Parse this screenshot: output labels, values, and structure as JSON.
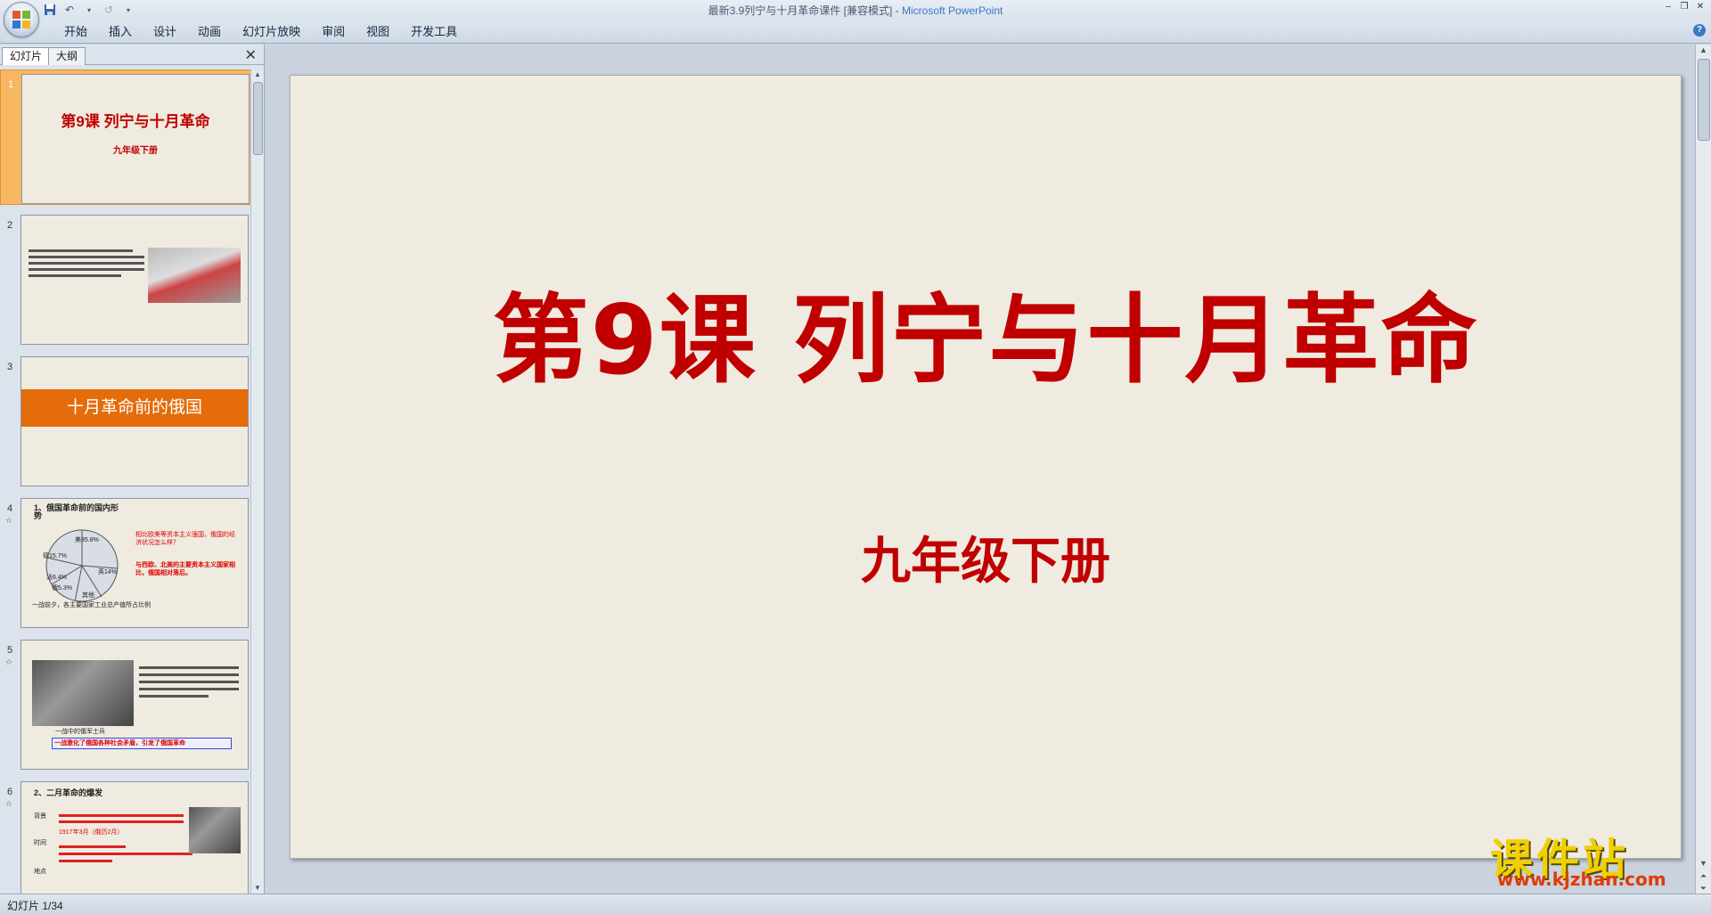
{
  "window": {
    "title": "最新3.9列宁与十月革命课件 [兼容模式] - ",
    "app_name": "Microsoft PowerPoint"
  },
  "ribbon": {
    "tabs": [
      "开始",
      "插入",
      "设计",
      "动画",
      "幻灯片放映",
      "审阅",
      "视图",
      "开发工具"
    ]
  },
  "left_pane": {
    "tabs": [
      "幻灯片",
      "大纲"
    ],
    "thumbnails": [
      {
        "num": "1",
        "title": "第9课 列宁与十月革命",
        "subtitle": "九年级下册"
      },
      {
        "num": "2",
        "text": "文字与图片"
      },
      {
        "num": "3",
        "banner": "十月革命前的俄国"
      },
      {
        "num": "4",
        "heading": "1、俄国革命前的国内形势",
        "pie_labels": [
          "美35.8%",
          "英14%",
          "德15.7%",
          "法6.4%",
          "俄5.3%",
          "其他"
        ],
        "q1": "相比欧美等资本主义强国，俄国的经济状况怎么样？",
        "q2": "与西欧、北美的主要资本主义国家相比，俄国相对落后。",
        "caption": "一战前夕，各主要国家工业总产值所占比例"
      },
      {
        "num": "5",
        "caption": "一战中的俄军士兵",
        "boxed": "一战激化了俄国各种社会矛盾，引发了俄国革命"
      },
      {
        "num": "6",
        "heading": "2、二月革命的爆发",
        "labels": [
          "背景",
          "时间",
          "地点"
        ],
        "date": "1917年3月（俄历2月）"
      }
    ]
  },
  "slide": {
    "title": "第9课 列宁与十月革命",
    "subtitle": "九年级下册"
  },
  "status": {
    "text": "幻灯片 1/34"
  },
  "watermark": {
    "top": "课件站",
    "bottom": "www.kjzhan.com"
  }
}
